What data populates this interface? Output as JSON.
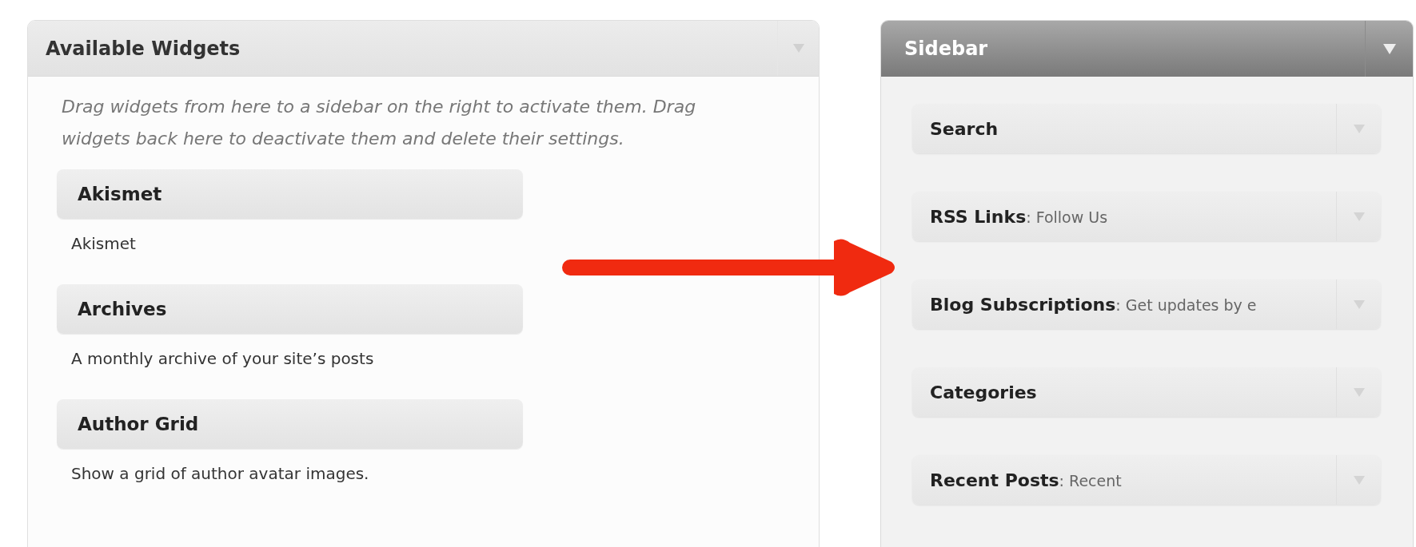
{
  "available_widgets": {
    "title": "Available Widgets",
    "description": "Drag widgets from here to a sidebar on the right to activate them. Drag widgets back here to deactivate them and delete their settings.",
    "widgets": [
      {
        "title": "Akismet",
        "description": "Akismet"
      },
      {
        "title": "Archives",
        "description": "A monthly archive of your site’s posts"
      },
      {
        "title": "Author Grid",
        "description": "Show a grid of author avatar images."
      }
    ]
  },
  "sidebar": {
    "title": "Sidebar",
    "items": [
      {
        "title": "Search"
      },
      {
        "title": "RSS Links",
        "detail": ": Follow Us"
      },
      {
        "title": "Blog Subscriptions",
        "detail": ": Get updates by e"
      },
      {
        "title": "Categories"
      },
      {
        "title": "Recent Posts",
        "detail": ": Recent"
      }
    ]
  }
}
